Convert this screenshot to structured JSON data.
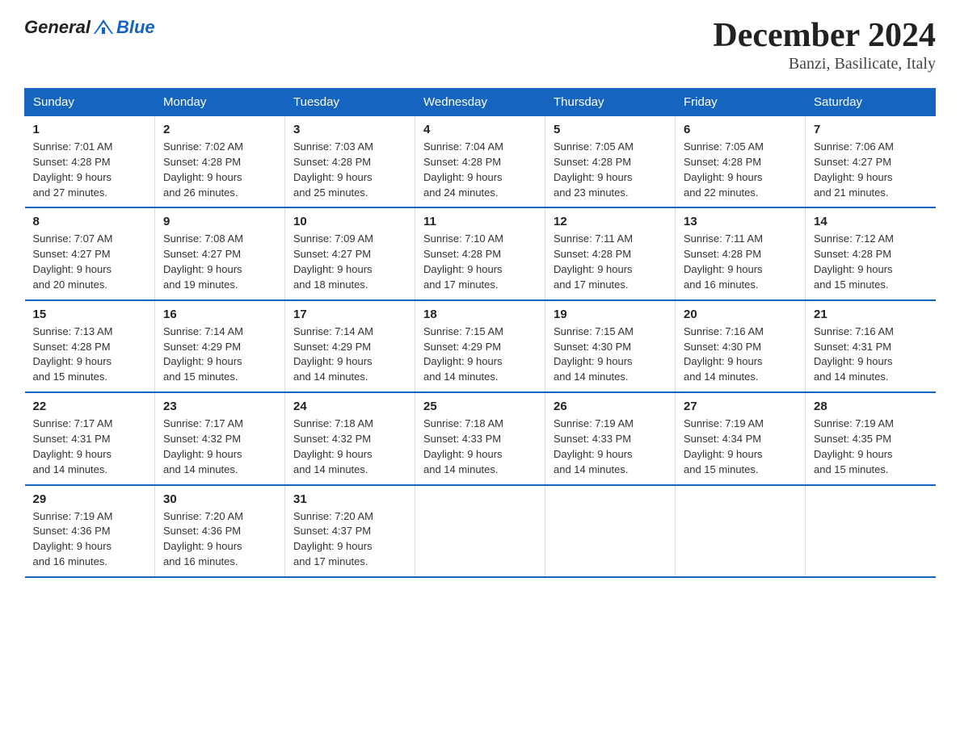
{
  "header": {
    "logo_general": "General",
    "logo_blue": "Blue",
    "title": "December 2024",
    "subtitle": "Banzi, Basilicate, Italy"
  },
  "weekdays": [
    "Sunday",
    "Monday",
    "Tuesday",
    "Wednesday",
    "Thursday",
    "Friday",
    "Saturday"
  ],
  "weeks": [
    [
      {
        "day": "1",
        "sunrise": "7:01 AM",
        "sunset": "4:28 PM",
        "daylight": "9 hours and 27 minutes."
      },
      {
        "day": "2",
        "sunrise": "7:02 AM",
        "sunset": "4:28 PM",
        "daylight": "9 hours and 26 minutes."
      },
      {
        "day": "3",
        "sunrise": "7:03 AM",
        "sunset": "4:28 PM",
        "daylight": "9 hours and 25 minutes."
      },
      {
        "day": "4",
        "sunrise": "7:04 AM",
        "sunset": "4:28 PM",
        "daylight": "9 hours and 24 minutes."
      },
      {
        "day": "5",
        "sunrise": "7:05 AM",
        "sunset": "4:28 PM",
        "daylight": "9 hours and 23 minutes."
      },
      {
        "day": "6",
        "sunrise": "7:05 AM",
        "sunset": "4:28 PM",
        "daylight": "9 hours and 22 minutes."
      },
      {
        "day": "7",
        "sunrise": "7:06 AM",
        "sunset": "4:27 PM",
        "daylight": "9 hours and 21 minutes."
      }
    ],
    [
      {
        "day": "8",
        "sunrise": "7:07 AM",
        "sunset": "4:27 PM",
        "daylight": "9 hours and 20 minutes."
      },
      {
        "day": "9",
        "sunrise": "7:08 AM",
        "sunset": "4:27 PM",
        "daylight": "9 hours and 19 minutes."
      },
      {
        "day": "10",
        "sunrise": "7:09 AM",
        "sunset": "4:27 PM",
        "daylight": "9 hours and 18 minutes."
      },
      {
        "day": "11",
        "sunrise": "7:10 AM",
        "sunset": "4:28 PM",
        "daylight": "9 hours and 17 minutes."
      },
      {
        "day": "12",
        "sunrise": "7:11 AM",
        "sunset": "4:28 PM",
        "daylight": "9 hours and 17 minutes."
      },
      {
        "day": "13",
        "sunrise": "7:11 AM",
        "sunset": "4:28 PM",
        "daylight": "9 hours and 16 minutes."
      },
      {
        "day": "14",
        "sunrise": "7:12 AM",
        "sunset": "4:28 PM",
        "daylight": "9 hours and 15 minutes."
      }
    ],
    [
      {
        "day": "15",
        "sunrise": "7:13 AM",
        "sunset": "4:28 PM",
        "daylight": "9 hours and 15 minutes."
      },
      {
        "day": "16",
        "sunrise": "7:14 AM",
        "sunset": "4:29 PM",
        "daylight": "9 hours and 15 minutes."
      },
      {
        "day": "17",
        "sunrise": "7:14 AM",
        "sunset": "4:29 PM",
        "daylight": "9 hours and 14 minutes."
      },
      {
        "day": "18",
        "sunrise": "7:15 AM",
        "sunset": "4:29 PM",
        "daylight": "9 hours and 14 minutes."
      },
      {
        "day": "19",
        "sunrise": "7:15 AM",
        "sunset": "4:30 PM",
        "daylight": "9 hours and 14 minutes."
      },
      {
        "day": "20",
        "sunrise": "7:16 AM",
        "sunset": "4:30 PM",
        "daylight": "9 hours and 14 minutes."
      },
      {
        "day": "21",
        "sunrise": "7:16 AM",
        "sunset": "4:31 PM",
        "daylight": "9 hours and 14 minutes."
      }
    ],
    [
      {
        "day": "22",
        "sunrise": "7:17 AM",
        "sunset": "4:31 PM",
        "daylight": "9 hours and 14 minutes."
      },
      {
        "day": "23",
        "sunrise": "7:17 AM",
        "sunset": "4:32 PM",
        "daylight": "9 hours and 14 minutes."
      },
      {
        "day": "24",
        "sunrise": "7:18 AM",
        "sunset": "4:32 PM",
        "daylight": "9 hours and 14 minutes."
      },
      {
        "day": "25",
        "sunrise": "7:18 AM",
        "sunset": "4:33 PM",
        "daylight": "9 hours and 14 minutes."
      },
      {
        "day": "26",
        "sunrise": "7:19 AM",
        "sunset": "4:33 PM",
        "daylight": "9 hours and 14 minutes."
      },
      {
        "day": "27",
        "sunrise": "7:19 AM",
        "sunset": "4:34 PM",
        "daylight": "9 hours and 15 minutes."
      },
      {
        "day": "28",
        "sunrise": "7:19 AM",
        "sunset": "4:35 PM",
        "daylight": "9 hours and 15 minutes."
      }
    ],
    [
      {
        "day": "29",
        "sunrise": "7:19 AM",
        "sunset": "4:36 PM",
        "daylight": "9 hours and 16 minutes."
      },
      {
        "day": "30",
        "sunrise": "7:20 AM",
        "sunset": "4:36 PM",
        "daylight": "9 hours and 16 minutes."
      },
      {
        "day": "31",
        "sunrise": "7:20 AM",
        "sunset": "4:37 PM",
        "daylight": "9 hours and 17 minutes."
      },
      null,
      null,
      null,
      null
    ]
  ],
  "labels": {
    "sunrise": "Sunrise:",
    "sunset": "Sunset:",
    "daylight": "Daylight:"
  }
}
